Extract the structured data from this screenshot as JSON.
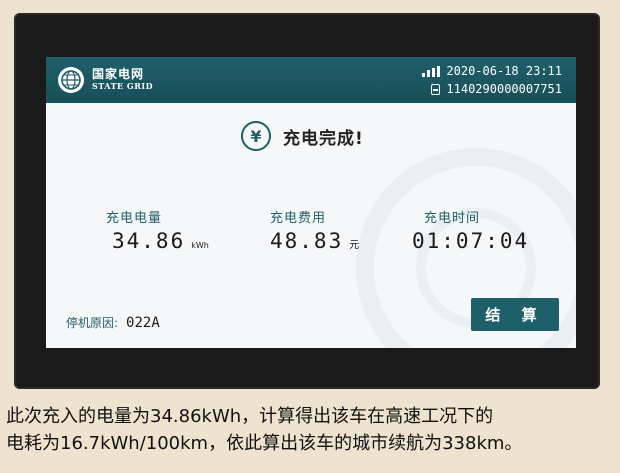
{
  "brand": {
    "name_cn": "国家电网",
    "name_en": "STATE GRID",
    "logo_icon": "state-grid-globe-icon"
  },
  "status": {
    "datetime": "2020-06-18 23:11",
    "card_number": "1140290000007751",
    "signal_icon": "signal-bars-icon",
    "card_icon": "charging-card-icon"
  },
  "result": {
    "icon": "yen-circle-icon",
    "title": "充电完成!"
  },
  "stats": {
    "energy": {
      "label": "充电电量",
      "value": "34.86",
      "unit": "kWh"
    },
    "cost": {
      "label": "充电费用",
      "value": "48.83",
      "unit": "元"
    },
    "time": {
      "label": "充电时间",
      "value": "01:07:04"
    }
  },
  "stop": {
    "label": "停机原因:",
    "code": "022A"
  },
  "actions": {
    "settle_label": "结 算"
  },
  "caption": {
    "line1": "此次充入的电量为34.86kWh，计算得出该车在高速工况下的",
    "line2": "电耗为16.7kWh/100km，依此算出该车的城市续航为338km。"
  },
  "colors": {
    "accent": "#1f5f6a",
    "screen_bg": "#f6f7f8",
    "page_bg": "#ede3cf"
  }
}
